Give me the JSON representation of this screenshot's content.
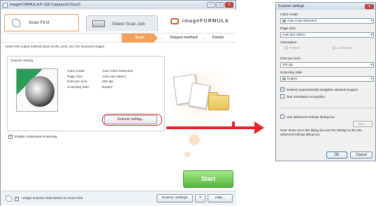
{
  "window": {
    "title": "imageFORMULA P-150 CaptureOnTouch",
    "minimize": "–",
    "maximize": "□",
    "close": "×"
  },
  "tabs": [
    {
      "label": "Scan First"
    },
    {
      "label": "Select Scan Job"
    }
  ],
  "brand": "imageFORMULA",
  "steps": {
    "scan": "Scan",
    "output": "Output method",
    "finish": "Finish",
    "arrow": "→"
  },
  "instruction": "Select the output method (save as file, print, etc.) for scanned images.",
  "scanner_setting": {
    "title": "Scanner setting:",
    "rows": [
      {
        "key": "Color mode:",
        "value": "Auto Color Detection"
      },
      {
        "key": "Page Size:",
        "value": "Auto size detect"
      },
      {
        "key": "Dots per inch:",
        "value": "200 dpi"
      },
      {
        "key": "Scanning Side:",
        "value": "Duplex"
      }
    ],
    "button": "Scanner setting..."
  },
  "enable_continuous": {
    "label": "Enable continuous scanning",
    "checked": true
  },
  "start_button": "Start",
  "bottom": {
    "assign_label": "Assign scanner Start button to Scan First",
    "env_button": "Environ. Settings",
    "question": "?",
    "help_button": "Help..."
  },
  "dialog": {
    "title": "Scanner settings",
    "close": "x",
    "color_mode_label": "Color mode:",
    "color_mode_value": "Auto Color Detection",
    "page_size_label": "Page Size:",
    "page_size_value": "Auto size detect",
    "orientation_label": "Orientation:",
    "portrait": "Portrait",
    "landscape": "Landscape",
    "dpi_label": "Dots per inch:",
    "dpi_value": "200 dpi",
    "side_label": "Scanning Side:",
    "side_value": "Duplex",
    "deskew": "Deskew (automatically straighten skewed images)",
    "text_orientation": "Text orientation recognition",
    "use_advanced": "Use advanced settings dialog box",
    "open_button": "Open...",
    "note": "Note: Items not in this dialog box use the settings in the Use advanced settings dialog box",
    "ok": "OK",
    "cancel": "Cancel",
    "dropdown_arrow": "▾",
    "check_mark": "✓"
  },
  "colors": {
    "accent_orange": "#f2a15a",
    "start_green": "#52b53a",
    "highlight_red": "#d9252a"
  },
  "icons": [
    "app-icon",
    "hand-icon",
    "scanner-icon",
    "canon-logo-icon",
    "document-illustration",
    "folder-icon",
    "red-arrow"
  ]
}
